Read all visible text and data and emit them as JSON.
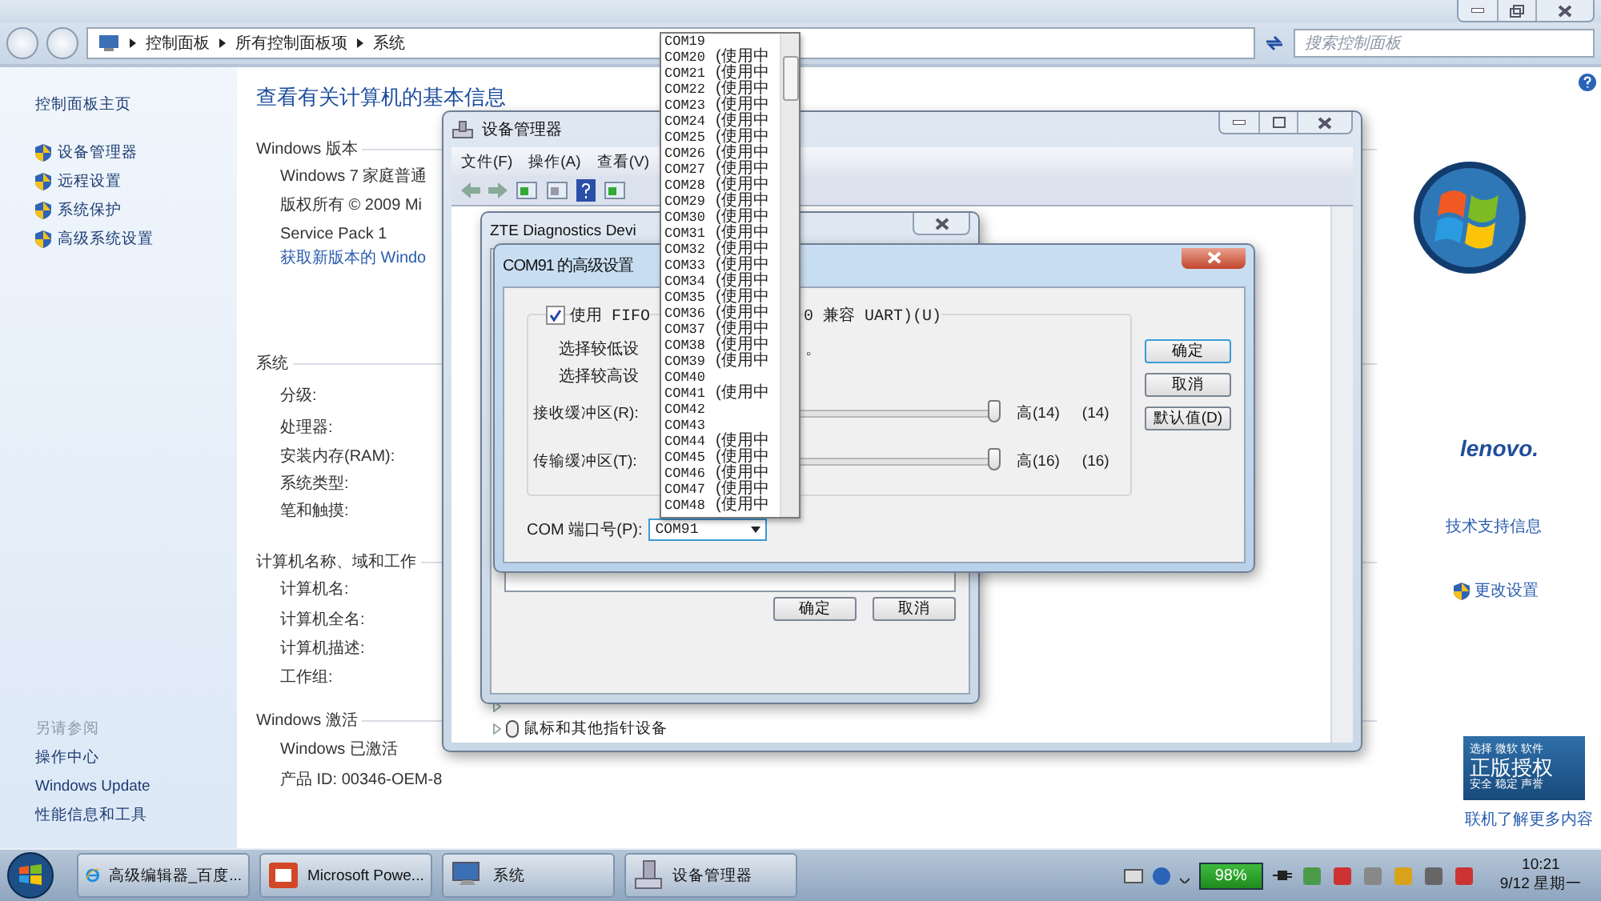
{
  "control_panel": {
    "address": [
      "控制面板",
      "所有控制面板项",
      "系统"
    ],
    "search_placeholder": "搜索控制面板",
    "sidebar": {
      "home": "控制面板主页",
      "tasks": [
        "设备管理器",
        "远程设置",
        "系统保护",
        "高级系统设置"
      ],
      "see_also_title": "另请参阅",
      "see_also": [
        "操作中心",
        "Windows Update",
        "性能信息和工具"
      ]
    },
    "heading": "查看有关计算机的基本信息",
    "sections": [
      {
        "title": "Windows 版本",
        "rows": [
          {
            "text": "Windows 7 家庭普通",
            "kind": "text"
          },
          {
            "text": "版权所有 © 2009 Mi",
            "kind": "text"
          },
          {
            "text": "Service Pack 1",
            "kind": "text"
          },
          {
            "text": "获取新版本的 Windo",
            "kind": "link"
          }
        ]
      },
      {
        "title": "系统",
        "rows": [
          {
            "text": "分级:",
            "kind": "text"
          },
          {
            "text": "处理器:",
            "kind": "text"
          },
          {
            "text": "安装内存(RAM):",
            "kind": "text"
          },
          {
            "text": "系统类型:",
            "kind": "text"
          },
          {
            "text": "笔和触摸:",
            "kind": "text"
          }
        ]
      },
      {
        "title": "计算机名称、域和工作",
        "rows": [
          {
            "text": "计算机名:",
            "kind": "text"
          },
          {
            "text": "计算机全名:",
            "kind": "text"
          },
          {
            "text": "计算机描述:",
            "kind": "text"
          },
          {
            "text": "工作组:",
            "kind": "text"
          }
        ]
      },
      {
        "title": "Windows 激活",
        "rows": [
          {
            "text": "Windows 已激活",
            "kind": "text"
          },
          {
            "text": "产品 ID: 00346-OEM-8",
            "kind": "text"
          }
        ]
      }
    ],
    "oem": {
      "brand": "lenovo.",
      "links": [
        {
          "text": "技术支持信息",
          "kind": "plain"
        },
        {
          "text": "更改设置",
          "kind": "shield"
        }
      ]
    },
    "genuine": {
      "lines": [
        "选择 微软 软件",
        "正版授权",
        "安全 稳定 声誉"
      ],
      "link": "联机了解更多内容"
    }
  },
  "device_manager": {
    "title": "设备管理器",
    "menu": [
      "文件(F)",
      "操作(A)",
      "查看(V)"
    ],
    "tree_items": [
      {
        "label": "鼠标和其他指针设备"
      }
    ]
  },
  "zte_dialog": {
    "title": "ZTE Diagnostics Devi",
    "buttons": [
      "确定",
      "取消"
    ]
  },
  "com_dialog": {
    "title": "COM91 的高级设置",
    "fifo": {
      "checked": true,
      "label_start": "使用 FIFO",
      "label_end": "0 兼容 UART)(U)"
    },
    "hints": [
      {
        "start": "选择较低设",
        "end": "。"
      },
      {
        "start": "选择较高设"
      }
    ],
    "sliders": [
      {
        "label": "接收缓冲区(R):",
        "level": 1,
        "setting": "高(14)",
        "reading": "(14)"
      },
      {
        "label": "传输缓冲区(T):",
        "level": 1,
        "setting": "高(16)",
        "reading": "(16)"
      }
    ],
    "port_label": "COM 端口号(P):",
    "port_value": "COM91",
    "buttons": [
      "确定",
      "取消",
      "默认值(D)"
    ]
  },
  "port_list": [
    {
      "name": "COM19"
    },
    {
      "name": "COM20",
      "note": "(使用中"
    },
    {
      "name": "COM21",
      "note": "(使用中"
    },
    {
      "name": "COM22",
      "note": "(使用中"
    },
    {
      "name": "COM23",
      "note": "(使用中"
    },
    {
      "name": "COM24",
      "note": "(使用中"
    },
    {
      "name": "COM25",
      "note": "(使用中"
    },
    {
      "name": "COM26",
      "note": "(使用中"
    },
    {
      "name": "COM27",
      "note": "(使用中"
    },
    {
      "name": "COM28",
      "note": "(使用中"
    },
    {
      "name": "COM29",
      "note": "(使用中"
    },
    {
      "name": "COM30",
      "note": "(使用中"
    },
    {
      "name": "COM31",
      "note": "(使用中"
    },
    {
      "name": "COM32",
      "note": "(使用中"
    },
    {
      "name": "COM33",
      "note": "(使用中"
    },
    {
      "name": "COM34",
      "note": "(使用中"
    },
    {
      "name": "COM35",
      "note": "(使用中"
    },
    {
      "name": "COM36",
      "note": "(使用中"
    },
    {
      "name": "COM37",
      "note": "(使用中"
    },
    {
      "name": "COM38",
      "note": "(使用中"
    },
    {
      "name": "COM39",
      "note": "(使用中"
    },
    {
      "name": "COM40"
    },
    {
      "name": "COM41",
      "note": "(使用中"
    },
    {
      "name": "COM42"
    },
    {
      "name": "COM43"
    },
    {
      "name": "COM44",
      "note": "(使用中"
    },
    {
      "name": "COM45",
      "note": "(使用中"
    },
    {
      "name": "COM46",
      "note": "(使用中"
    },
    {
      "name": "COM47",
      "note": "(使用中"
    },
    {
      "name": "COM48",
      "note": "(使用中"
    }
  ],
  "taskbar": {
    "items": [
      {
        "label": "高级编辑器_百度...",
        "kind": "browser"
      },
      {
        "label": "Microsoft Powe...",
        "kind": "slides"
      },
      {
        "label": "系统",
        "kind": "system"
      },
      {
        "label": "设备管理器",
        "kind": "devices"
      }
    ],
    "battery": "98%",
    "time": "10:21",
    "date": "9/12 星期一"
  }
}
